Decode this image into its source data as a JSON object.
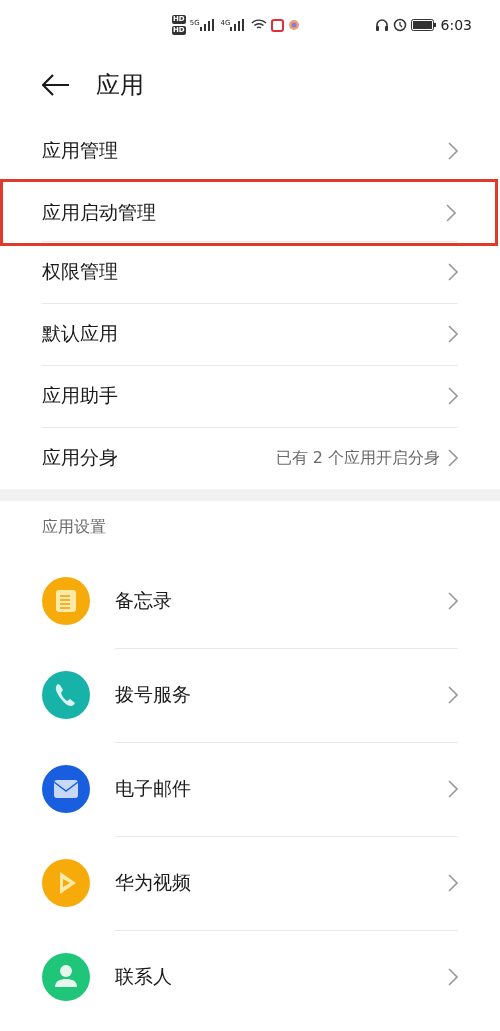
{
  "status_bar": {
    "sim_labels": [
      "HD",
      "HD"
    ],
    "networks": [
      "5G",
      "4G"
    ],
    "time": "6:03"
  },
  "header": {
    "title": "应用"
  },
  "menu": [
    {
      "label": "应用管理",
      "highlighted": false
    },
    {
      "label": "应用启动管理",
      "highlighted": true
    },
    {
      "label": "权限管理",
      "highlighted": false
    },
    {
      "label": "默认应用",
      "highlighted": false
    },
    {
      "label": "应用助手",
      "highlighted": false
    },
    {
      "label": "应用分身",
      "value": "已有 2 个应用开启分身",
      "highlighted": false
    }
  ],
  "section": {
    "title": "应用设置"
  },
  "apps": [
    {
      "name": "备忘录",
      "kind": "notes"
    },
    {
      "name": "拨号服务",
      "kind": "phone"
    },
    {
      "name": "电子邮件",
      "kind": "mail"
    },
    {
      "name": "华为视频",
      "kind": "video"
    },
    {
      "name": "联系人",
      "kind": "contact"
    }
  ]
}
